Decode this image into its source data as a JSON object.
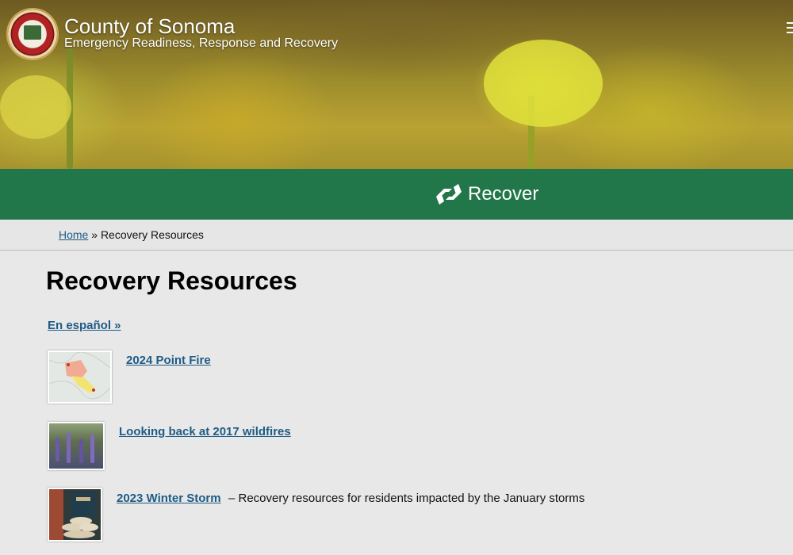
{
  "header": {
    "title": "County of Sonoma",
    "subtitle": "Emergency Readiness, Response and Recovery"
  },
  "phase_bar": {
    "label": "Recover",
    "icon": "handshake-icon",
    "color": "#22774a"
  },
  "breadcrumb": {
    "home": "Home",
    "separator": " » ",
    "current": "Recovery Resources"
  },
  "main": {
    "title": "Recovery Resources",
    "language_link": "En español »",
    "resources": [
      {
        "label": "2024 Point Fire",
        "description": "",
        "thumbnail": "fire-map-thumbnail"
      },
      {
        "label": "Looking back at 2017 wildfires",
        "description": "",
        "thumbnail": "lupine-flowers-thumbnail"
      },
      {
        "label": "2023 Winter Storm",
        "description": " – Recovery resources for residents impacted by the January storms",
        "thumbnail": "sandbags-thumbnail"
      }
    ]
  },
  "colors": {
    "link": "#1e5b86",
    "background": "#e8e8e8",
    "accent_green": "#22774a"
  }
}
